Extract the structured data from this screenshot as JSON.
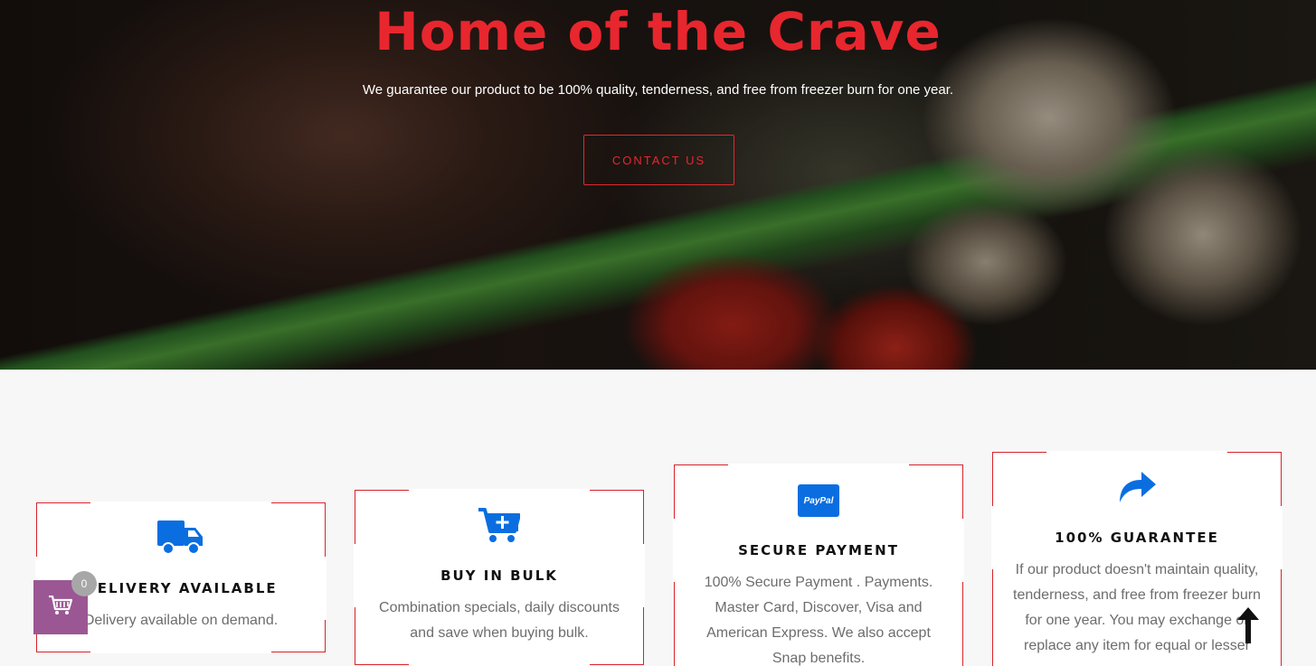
{
  "hero": {
    "title": "Home of the Crave",
    "subtitle": "We guarantee our product to be 100% quality, tenderness, and free from freezer burn for one year.",
    "cta_label": "CONTACT US"
  },
  "features": [
    {
      "icon": "delivery-truck-icon",
      "title": "DELIVERY AVAILABLE",
      "text": "Delivery available on demand."
    },
    {
      "icon": "cart-plus-icon",
      "title": "BUY IN BULK",
      "text": "Combination specials, daily discounts and save when buying bulk."
    },
    {
      "icon": "paypal-icon",
      "icon_text": "PayPal",
      "title": "SECURE PAYMENT",
      "text": "100% Secure Payment . Payments. Master Card, Discover, Visa and American Express. We also accept Snap benefits."
    },
    {
      "icon": "share-arrow-icon",
      "title": "100% GUARANTEE",
      "text": "If our product doesn't maintain quality, tenderness, and free from freezer burn for one year. You may exchange or replace any item for equal or lesser"
    }
  ],
  "cart": {
    "count": "0"
  },
  "colors": {
    "accent": "#e8262e",
    "icon_blue": "#0b6ee0",
    "cart_bg": "#9b5794"
  }
}
